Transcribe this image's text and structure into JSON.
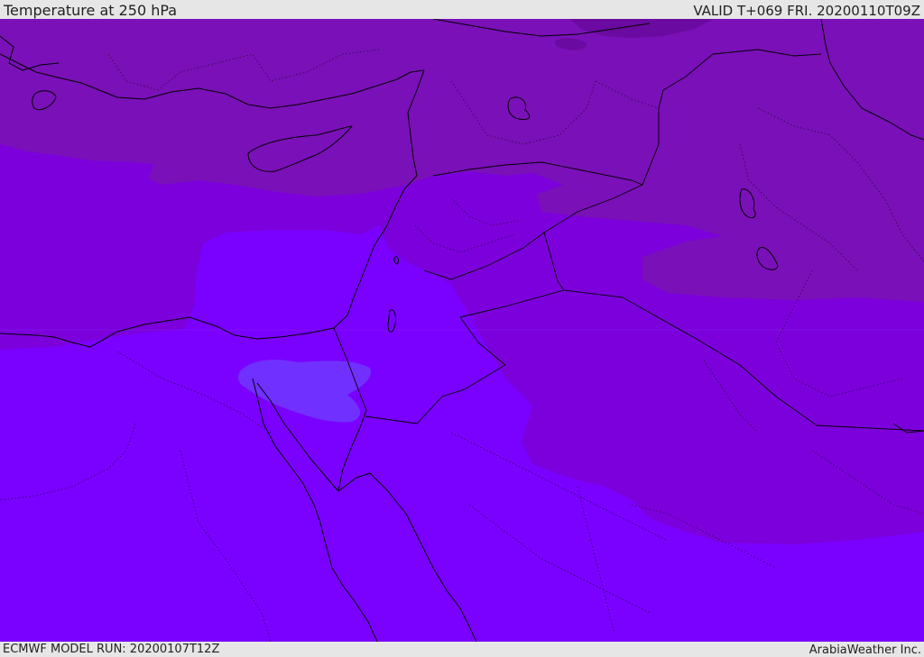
{
  "header": {
    "title": "Temperature at 250 hPa",
    "valid": "VALID T+069 FRI. 20200110T09Z"
  },
  "footer": {
    "model_run": "ECMWF MODEL RUN: 20200107T12Z",
    "credit": "ArabiaWeather Inc."
  },
  "colors": {
    "band_coldest": "#6a0aa0",
    "band_cold": "#7a10b8",
    "band_mid": "#7c00dc",
    "band_base": "#7a00ff",
    "band_warm": "#7030ff",
    "coastline": "#000000",
    "border": "#000000"
  }
}
